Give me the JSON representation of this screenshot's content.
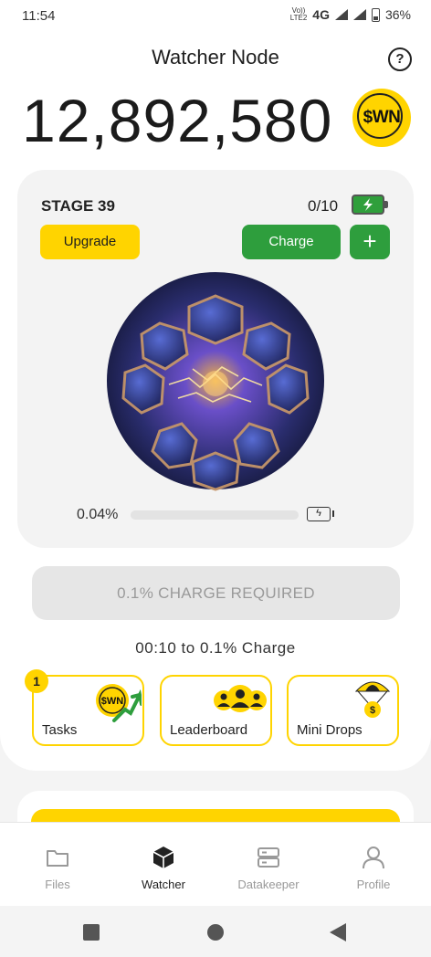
{
  "status_bar": {
    "time": "11:54",
    "volte_top": "Vo))",
    "volte_bottom": "LTE2",
    "network": "4G",
    "battery_percent": "36%"
  },
  "header": {
    "title": "Watcher Node",
    "help_icon": "question-circle-icon"
  },
  "balance": {
    "value": "12,892,580",
    "token_label": "$WN"
  },
  "stage_card": {
    "stage_label": "STAGE 39",
    "charge_count": "0/10",
    "upgrade_label": "Upgrade",
    "charge_label": "Charge",
    "plus_label": "+",
    "progress_label": "0.04%",
    "progress_value": 0.0004,
    "charge_battery_glyph": "ϟ"
  },
  "charge_required_label": "0.1% CHARGE REQUIRED",
  "timer_text": "00:10 to 0.1% Charge",
  "tiles": [
    {
      "label": "Tasks",
      "badge": "1",
      "icon": "wn-coin-arrow-icon",
      "icon_text": "$WN"
    },
    {
      "label": "Leaderboard",
      "icon": "users-group-icon"
    },
    {
      "label": "Mini Drops",
      "icon": "parachute-coin-icon",
      "icon_text": "$"
    }
  ],
  "bottom_nav": [
    {
      "label": "Files",
      "icon": "folder-icon",
      "active": false
    },
    {
      "label": "Watcher",
      "icon": "cube-icon",
      "active": true
    },
    {
      "label": "Datakeeper",
      "icon": "server-icon",
      "active": false
    },
    {
      "label": "Profile",
      "icon": "person-icon",
      "active": false
    }
  ],
  "colors": {
    "accent_yellow": "#ffd400",
    "accent_green": "#2e9e3d",
    "background": "#f4f4f4"
  }
}
